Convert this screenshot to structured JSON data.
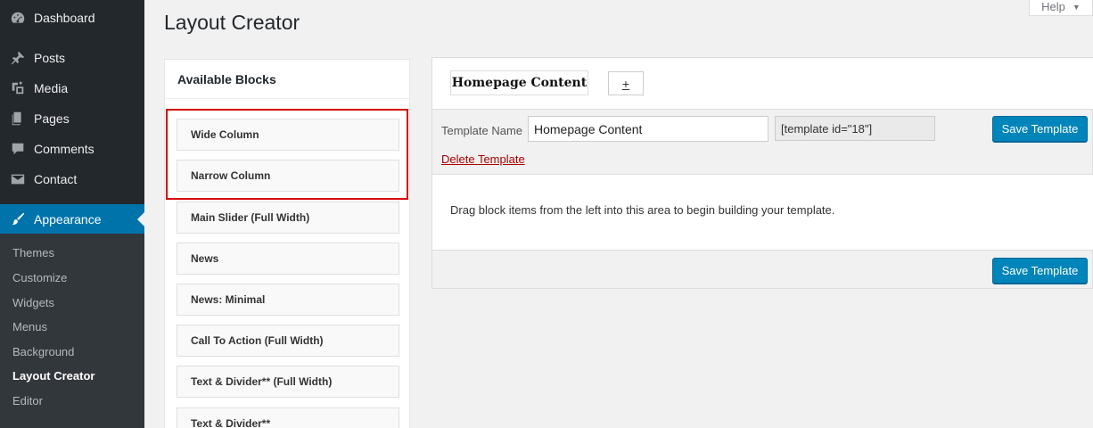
{
  "sidebar": {
    "menu": [
      {
        "label": "Dashboard",
        "icon": "dashboard-icon"
      },
      {
        "label": "Posts",
        "icon": "pushpin-icon"
      },
      {
        "label": "Media",
        "icon": "media-icon"
      },
      {
        "label": "Pages",
        "icon": "pages-icon"
      },
      {
        "label": "Comments",
        "icon": "comment-icon"
      },
      {
        "label": "Contact",
        "icon": "envelope-icon"
      },
      {
        "label": "Appearance",
        "icon": "paintbrush-icon"
      }
    ],
    "submenu": [
      "Themes",
      "Customize",
      "Widgets",
      "Menus",
      "Background",
      "Layout Creator",
      "Editor"
    ],
    "active_submenu": "Layout Creator"
  },
  "header": {
    "title": "Layout Creator",
    "help_label": "Help"
  },
  "blocks": {
    "title": "Available Blocks",
    "items": [
      "Wide Column",
      "Narrow Column",
      "Main Slider (Full Width)",
      "News",
      "News: Minimal",
      "Call To Action (Full Width)",
      "Text & Divider** (Full Width)",
      "Text & Divider**"
    ]
  },
  "template": {
    "tab_label": "Homepage Content",
    "add_tab_label": "+",
    "name_label": "Template Name",
    "name_value": "Homepage Content",
    "shortcode": "[template id=\"18\"]",
    "save_label": "Save Template",
    "delete_label": "Delete Template",
    "drop_hint": "Drag block items from the left into this area to begin building your template."
  },
  "colors": {
    "sidebar_bg": "#23282d",
    "accent": "#0073aa",
    "button": "#0085ba",
    "highlight": "#d40000",
    "delete_link": "#aa0000"
  }
}
